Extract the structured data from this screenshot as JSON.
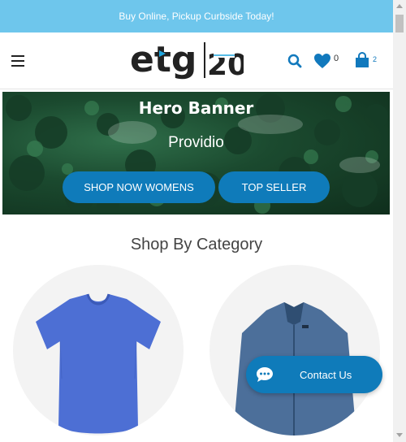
{
  "announcement": {
    "text": "Buy Online, Pickup Curbside Today!"
  },
  "header": {
    "logo_text": "etg",
    "logo_badge": "20",
    "wishlist_count": "0",
    "cart_count": "2",
    "accent_color": "#1179bd"
  },
  "hero": {
    "title": "Hero Banner",
    "subtitle": "Providio",
    "buttons": [
      "SHOP NOW WOMENS",
      "TOP SELLER"
    ]
  },
  "category_section": {
    "title": "Shop By Category"
  },
  "contact": {
    "label": "Contact Us"
  },
  "colors": {
    "announcement_bg": "#6ec6ec",
    "button_bg": "#0f7bba"
  }
}
